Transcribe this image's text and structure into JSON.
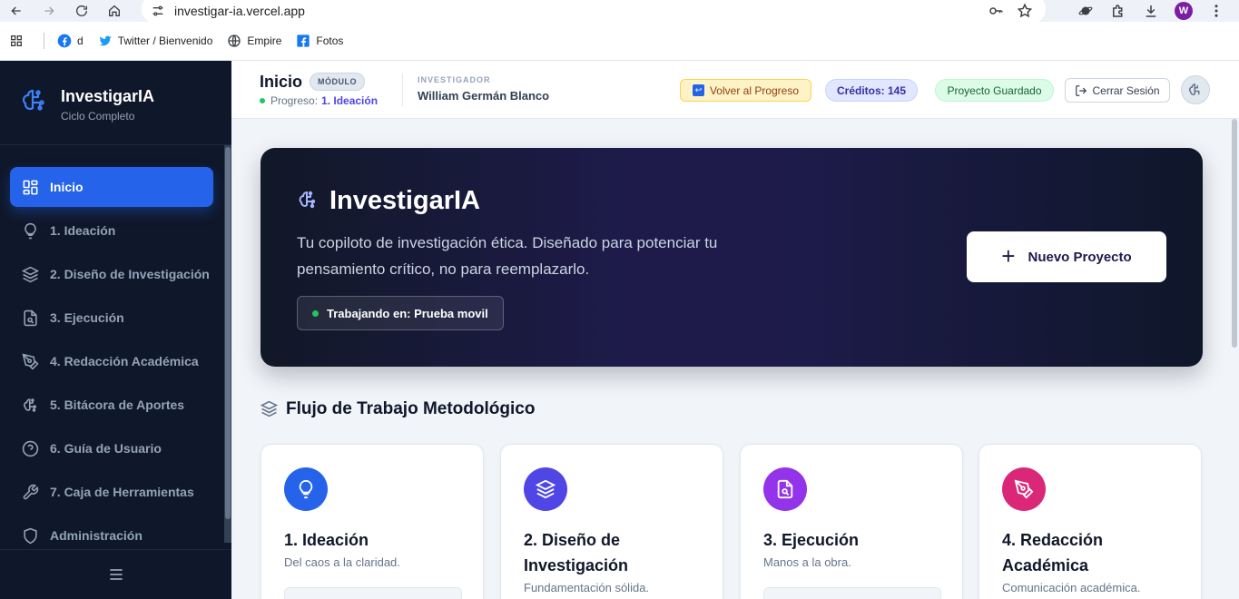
{
  "browser": {
    "url": "investigar-ia.vercel.app",
    "bookmarks": [
      {
        "label": "d"
      },
      {
        "label": "Twitter / Bienvenido"
      },
      {
        "label": "Empire"
      },
      {
        "label": "Fotos"
      }
    ],
    "profile_initial": "W"
  },
  "sidebar": {
    "brand_title": "InvestigarIA",
    "brand_subtitle": "Ciclo Completo",
    "items": [
      {
        "label": "Inicio",
        "icon": "grid-icon",
        "active": true
      },
      {
        "label": "1. Ideación",
        "icon": "lightbulb-icon"
      },
      {
        "label": "2. Diseño de Investigación",
        "icon": "layers-icon"
      },
      {
        "label": "3. Ejecución",
        "icon": "file-search-icon"
      },
      {
        "label": "4. Redacción Académica",
        "icon": "pen-tool-icon"
      },
      {
        "label": "5. Bitácora de Aportes",
        "icon": "brain-icon"
      },
      {
        "label": "6. Guía de Usuario",
        "icon": "help-circle-icon"
      },
      {
        "label": "7. Caja de Herramientas",
        "icon": "wrench-icon"
      },
      {
        "label": "Administración",
        "icon": "shield-icon"
      }
    ]
  },
  "header": {
    "title": "Inicio",
    "badge": "MÓDULO",
    "progress_label": "Progreso:",
    "progress_value": "1. Ideación",
    "investigator_label": "INVESTIGADOR",
    "investigator_name": "William Germán Blanco",
    "volver_label": "Volver al Progreso",
    "credits_label": "Créditos: 145",
    "saved_label": "Proyecto Guardado",
    "logout_label": "Cerrar Sesión"
  },
  "hero": {
    "title": "InvestigarIA",
    "description": "Tu copiloto de investigación ética. Diseñado para potenciar tu pensamiento crítico, no para reemplazarlo.",
    "working_on": "Trabajando en: Prueba movil",
    "new_project_label": "Nuevo Proyecto"
  },
  "workflow": {
    "title": "Flujo de Trabajo Metodológico",
    "cards": [
      {
        "title": "1. Ideación",
        "subtitle": "Del caos a la claridad.",
        "color": "#2563eb",
        "icon": "lightbulb-icon"
      },
      {
        "title": "2. Diseño de Investigación",
        "subtitle": "Fundamentación sólida.",
        "color": "#4f46e5",
        "icon": "layers-icon"
      },
      {
        "title": "3. Ejecución",
        "subtitle": "Manos a la obra.",
        "color": "#9333ea",
        "icon": "file-search-icon"
      },
      {
        "title": "4. Redacción Académica",
        "subtitle": "Comunicación académica.",
        "color": "#db2777",
        "icon": "pen-tool-icon"
      }
    ]
  },
  "colors": {
    "accent": "#2563eb",
    "sidebar_bg": "#0f172a",
    "hero_gradient_mid": "#1e1b4b"
  }
}
